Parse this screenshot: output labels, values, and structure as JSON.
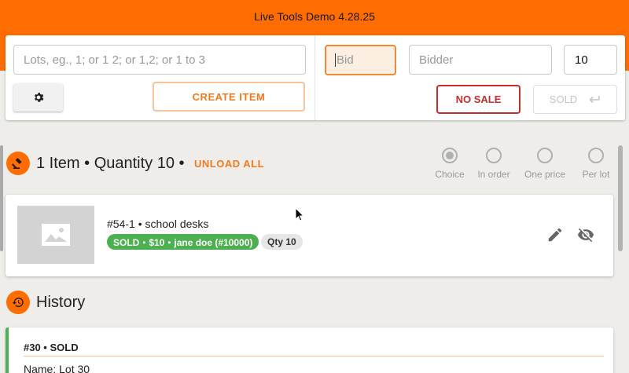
{
  "app": {
    "title": "Live Tools Demo 4.28.25"
  },
  "controls": {
    "lots_placeholder": "Lots, eg., 1; or 1 2; or 1,2; or 1 to 3",
    "bid_placeholder": "Bid",
    "bidder_placeholder": "Bidder",
    "quantity_value": "10",
    "create_item_label": "CREATE ITEM",
    "no_sale_label": "NO SALE",
    "sold_label": "SOLD",
    "settings_icon": "gear-icon",
    "sold_icon": "return-arrow-icon"
  },
  "summary": {
    "text": "1 Item • Quantity 10 •",
    "unload_label": "UNLOAD ALL",
    "icon": "gavel-icon",
    "order_options": [
      {
        "label": "Choice",
        "selected": true
      },
      {
        "label": "In order",
        "selected": false
      },
      {
        "label": "One price",
        "selected": false
      },
      {
        "label": "Per lot",
        "selected": false
      }
    ]
  },
  "item": {
    "title": "#54-1 • school desks",
    "status_chip": "SOLD・$10・jane doe (#10000)",
    "qty_chip": "Qty 10",
    "image_icon": "image-placeholder-icon",
    "edit_icon": "pencil-icon",
    "hide_icon": "eye-off-icon"
  },
  "history": {
    "title": "History",
    "icon": "history-icon",
    "entries": [
      {
        "header": "#30 • SOLD",
        "name": "Name: Lot 30"
      }
    ]
  },
  "colors": {
    "brand": "#ff6d00",
    "accent_text": "#f07b1e",
    "no_sale": "#c72c2c",
    "sold_green": "#4caf50"
  }
}
